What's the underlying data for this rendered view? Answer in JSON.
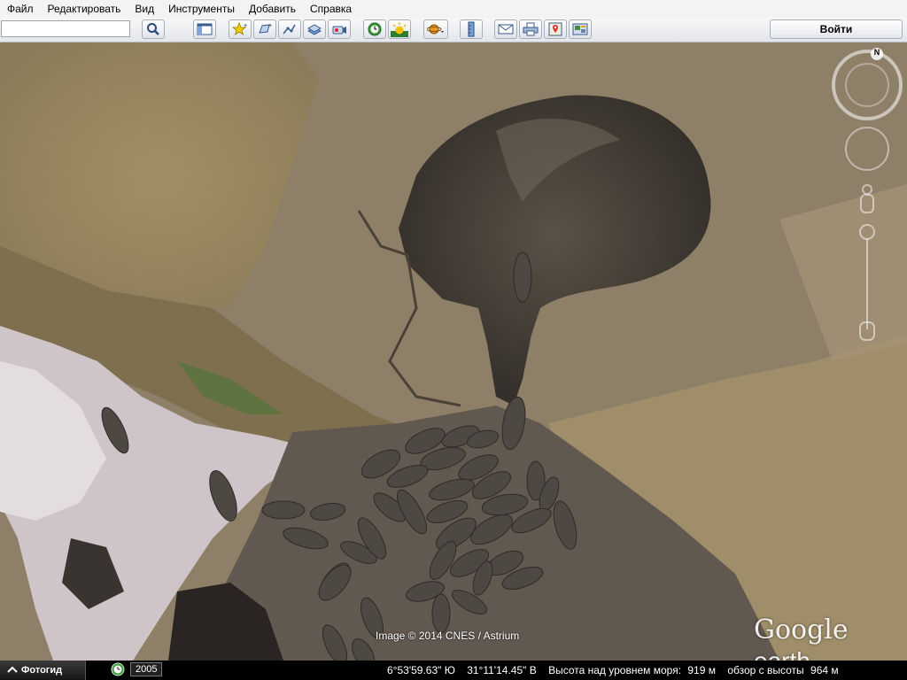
{
  "menu": {
    "items": [
      "Файл",
      "Редактировать",
      "Вид",
      "Инструменты",
      "Добавить",
      "Справка"
    ]
  },
  "toolbar": {
    "search_value": "",
    "login_label": "Войти",
    "buttons": [
      "search-icon",
      "sidebar-icon",
      "placemark-icon",
      "polygon-icon",
      "path-icon",
      "overlay-icon",
      "record-tour-icon",
      "historical-imagery-icon",
      "sunlight-icon",
      "planets-icon",
      "ruler-icon",
      "email-icon",
      "print-icon",
      "maps-icon",
      "save-image-icon"
    ]
  },
  "map": {
    "attribution": "Image © 2014 CNES / Astrium",
    "logo_google": "Google",
    "logo_earth": "earth",
    "compass_north": "N"
  },
  "status": {
    "tour_label": "Фотогид",
    "year": "2005",
    "latitude": "6°53'59.63\" Ю",
    "longitude": "31°11'14.45\" В",
    "elevation_label": "Высота над уровнем моря:",
    "elevation_value": "919 м",
    "eye_label": "обзор с высоты",
    "eye_value": "964 м"
  }
}
